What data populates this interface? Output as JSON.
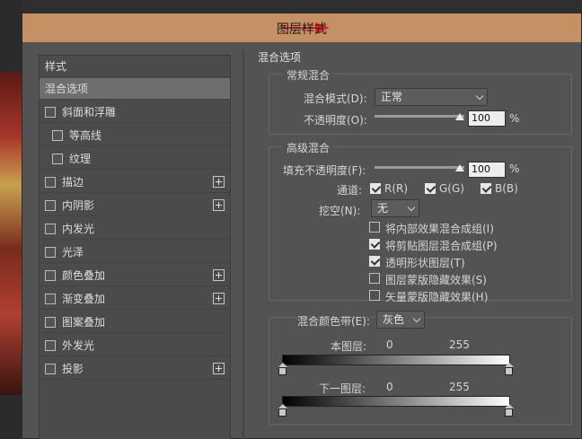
{
  "dialog": {
    "title": "图层样式"
  },
  "styles_panel": {
    "header": "样式",
    "blend_options": "混合选项",
    "items": [
      {
        "label": "斜面和浮雕",
        "has_plus": false
      },
      {
        "label": "等高线",
        "has_plus": false
      },
      {
        "label": "纹理",
        "has_plus": false
      },
      {
        "label": "描边",
        "has_plus": true
      },
      {
        "label": "内阴影",
        "has_plus": true
      },
      {
        "label": "内发光",
        "has_plus": false
      },
      {
        "label": "光泽",
        "has_plus": false
      },
      {
        "label": "颜色叠加",
        "has_plus": true
      },
      {
        "label": "渐变叠加",
        "has_plus": true
      },
      {
        "label": "图案叠加",
        "has_plus": false
      },
      {
        "label": "外发光",
        "has_plus": false
      },
      {
        "label": "投影",
        "has_plus": true
      }
    ]
  },
  "blending": {
    "section_title": "混合选项",
    "general": {
      "title": "常规混合",
      "mode_label": "混合模式(D):",
      "mode_value": "正常",
      "opacity_label": "不透明度(O):",
      "opacity_value": "100",
      "opacity_unit": "%",
      "opacity_level": 1.0
    },
    "advanced": {
      "title": "高级混合",
      "fill_label": "填充不透明度(F):",
      "fill_value": "100",
      "fill_unit": "%",
      "fill_level": 1.0,
      "channels_label": "通道:",
      "channel_r": "R(R)",
      "channel_g": "G(G)",
      "channel_b": "B(B)",
      "knockout_label": "挖空(N):",
      "knockout_value": "无",
      "options": [
        {
          "label": "将内部效果混合成组(I)",
          "checked": false
        },
        {
          "label": "将剪贴图层混合成组(P)",
          "checked": true
        },
        {
          "label": "透明形状图层(T)",
          "checked": true
        },
        {
          "label": "图层蒙版隐藏效果(S)",
          "checked": false
        },
        {
          "label": "矢量蒙版隐藏效果(H)",
          "checked": false
        }
      ]
    },
    "blend_if": {
      "label": "混合颜色带(E):",
      "value": "灰色",
      "this_layer": "本图层:",
      "this_min": "0",
      "this_max": "255",
      "underlying": "下一图层:",
      "under_min": "0",
      "under_max": "255"
    }
  },
  "colors": {
    "titlebar": "#c69065",
    "arrow": "#e02020"
  }
}
